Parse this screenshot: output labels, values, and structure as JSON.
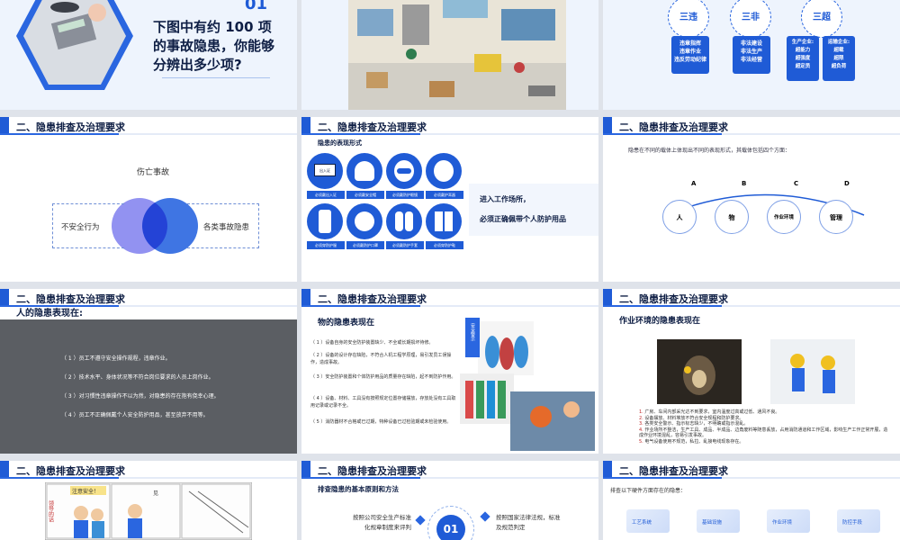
{
  "slide1": {
    "number": "01",
    "title": "下图中有约 100 项的事故隐患，你能够分辨出多少项?"
  },
  "slide3": {
    "circles": [
      "三违",
      "三非",
      "三超"
    ],
    "boxes": [
      "违章指挥\n违章作业\n违反劳动纪律",
      "非法建设\n非法生产\n非法经营",
      "生产企业:\n超能力\n超强度\n超定员",
      "运输企业:\n超载\n超限\n超负荷"
    ]
  },
  "section_title": "二、隐患排查及治理要求",
  "slide4": {
    "top": "伤亡事故",
    "left": "不安全行为",
    "right": "各类事故隐患"
  },
  "slide5": {
    "subtitle": "隐患的表现形式",
    "signs": [
      "必须戴出入证",
      "必须戴安全帽",
      "必须戴防护眼镜",
      "必须戴护耳器",
      "必须穿防护服",
      "必须戴防护口罩",
      "必须戴防护手套",
      "必须穿防护鞋"
    ],
    "sign_badge": "出入证",
    "text_line1": "进入工作场所，",
    "text_line2": "必须正确佩带个人防护用品"
  },
  "slide6": {
    "intro": "隐患在不同的载体上体现出不同的表现形式，其载体包括四个方面：",
    "items": [
      {
        "letter": "A",
        "label": "人"
      },
      {
        "letter": "B",
        "label": "物"
      },
      {
        "letter": "C",
        "label": "作业环境"
      },
      {
        "letter": "D",
        "label": "管理"
      }
    ]
  },
  "slide7": {
    "subtitle": "人的隐患表现在:",
    "items": [
      "（ 1 ）员工不遵守安全操作规程，违章作业。",
      "（ 2 ）技术水平、身体状况等不符合岗位要求的人员上岗作业。",
      "（ 3 ）对习惯性违章操作不以为然，对隐患的存在抱有侥幸心理。",
      "（ 4 ）员工不正确佩戴个人安全防护用品，甚至放弃不用等。"
    ]
  },
  "slide8": {
    "subtitle": "物的隐患表现在",
    "items": [
      "（ 1 ）设备自身的安全防护装置缺少、不全或长期损坏待修。",
      "（ 2 ）设备的设计存在缺陷，不符合人机工程学原理，易引发员工误操作，造成事故。",
      "（ 3 ）安全防护装置和个体防护用品的质量存在缺陷，起不到防护作用。",
      "（ 4 ）设备、材料、工具没有按照规定位置存储摆放，存放处没有工具取用记录或记录不全。",
      "（ 5 ）消防器材不合格或已过期，特种设备已过检验期或未检验使用。"
    ],
    "sign_text": "安全警示"
  },
  "slide9": {
    "subtitle": "作业环境的隐患表现在",
    "items": [
      "广房、车间内部采光达不到要求，室内温度过高或过低、通风不良。",
      "设备摆放、材料堆放不符合安全规程和防护要求。",
      "各类安全警示、指示标志缺少，不明确或指示混乱。",
      "作业场所不整洁，生产工具、成品、半成品、边角废料等随意丢放，占用消防通道和工作区域，影响生产工作正常开展，造成作业环境混乱，容易引发事故。",
      "电气设备使用不规范，私拉、乱接电线现象存在。"
    ]
  },
  "slide10": {
    "caption1": "注意安全！",
    "caption2": "领导的话",
    "caption3": "见"
  },
  "slide11": {
    "subtitle": "排查隐患的基本原则和方法",
    "left": "按照公司安全生产标准化规章制度来评判",
    "right": "按照国家法律法规，标准及规范判定",
    "number": "01"
  },
  "slide12": {
    "intro": "排查以下硬件方面存在的隐患：",
    "cards": [
      "工艺系统",
      "基础设施",
      "作业环境",
      "防控手段"
    ]
  }
}
